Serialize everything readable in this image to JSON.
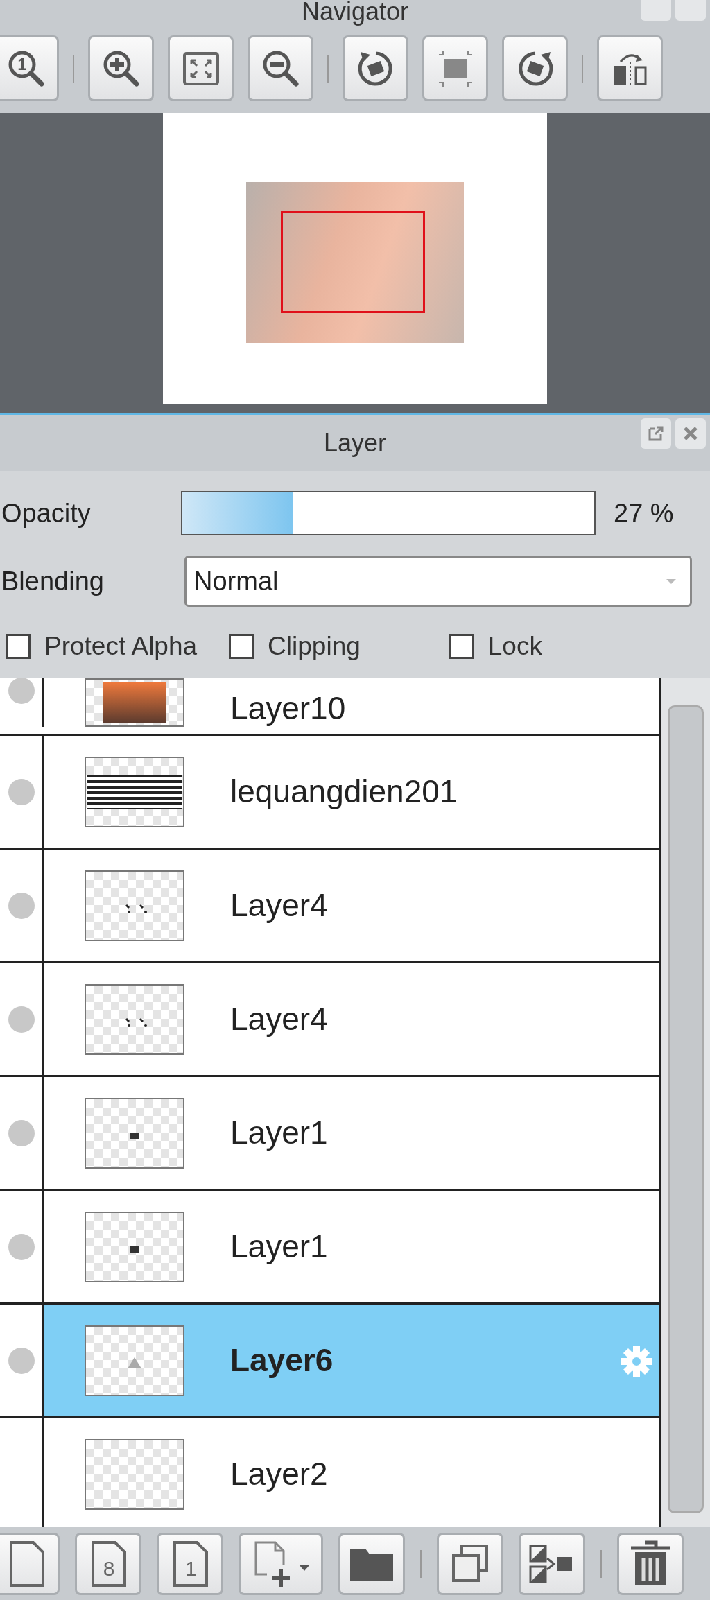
{
  "navigator": {
    "title": "Navigator",
    "zoom_reset_glyph": "1"
  },
  "layer_panel": {
    "title": "Layer",
    "opacity": {
      "label": "Opacity",
      "level": 0.27,
      "reading": "27 %"
    },
    "blending": {
      "label": "Blending",
      "value": "Normal"
    },
    "options": [
      {
        "label": "Protect Alpha",
        "checked": false
      },
      {
        "label": "Clipping",
        "checked": false
      },
      {
        "label": "Lock",
        "checked": false
      }
    ],
    "layers": [
      {
        "name": "Layer10",
        "kind": "photo",
        "visible": true,
        "selected": false
      },
      {
        "name": "lequangdien201",
        "kind": "text",
        "visible": true,
        "selected": false
      },
      {
        "name": "Layer4",
        "kind": "dots",
        "visible": true,
        "selected": false
      },
      {
        "name": "Layer4",
        "kind": "dots",
        "visible": true,
        "selected": false
      },
      {
        "name": "Layer1",
        "kind": "mark",
        "visible": true,
        "selected": false
      },
      {
        "name": "Layer1",
        "kind": "mark",
        "visible": true,
        "selected": false
      },
      {
        "name": "Layer6",
        "kind": "triangle",
        "visible": true,
        "selected": true
      },
      {
        "name": "Layer2",
        "kind": "empty",
        "visible": false,
        "selected": false
      }
    ],
    "toolbar": {
      "layer8_glyph": "8",
      "layer1_glyph": "1"
    }
  }
}
